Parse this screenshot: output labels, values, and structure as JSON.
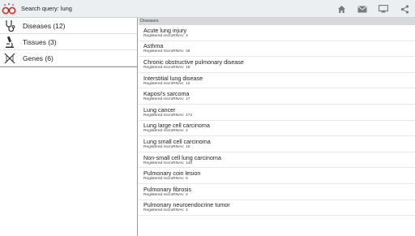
{
  "header": {
    "title": "Search query: lung",
    "actions": [
      {
        "name": "home-icon"
      },
      {
        "name": "mail-icon"
      },
      {
        "name": "cast-screen-icon"
      },
      {
        "name": "share-icon"
      }
    ]
  },
  "sidebar": {
    "items": [
      {
        "label": "Diseases (12)",
        "icon": "stethoscope-icon"
      },
      {
        "label": "Tissues (3)",
        "icon": "microscope-icon"
      },
      {
        "label": "Genes (6)",
        "icon": "dna-icon"
      }
    ]
  },
  "main": {
    "section_label": "Diseases",
    "sub_prefix": "Registered microRNAs:",
    "rows": [
      {
        "name": "Acute lung injury",
        "count": "3"
      },
      {
        "name": "Asthma",
        "count": "26"
      },
      {
        "name": "Chronic obstructive pulmonary disease",
        "count": "18"
      },
      {
        "name": "Interstitial lung disease",
        "count": "12"
      },
      {
        "name": "Kaposi's sarcoma",
        "count": "17"
      },
      {
        "name": "Lung cancer",
        "count": "172"
      },
      {
        "name": "Lung large cell carcinoma",
        "count": "2"
      },
      {
        "name": "Lung small cell carcinoma",
        "count": "10"
      },
      {
        "name": "Non-small cell lung carcinoma",
        "count": "140"
      },
      {
        "name": "Pulmonary coin lesion",
        "count": "5"
      },
      {
        "name": "Pulmonary fibrosis",
        "count": "2"
      },
      {
        "name": "Pulmonary neuroendocrine tumor",
        "count": "2"
      }
    ]
  },
  "colors": {
    "actionbar": "#eceff2",
    "section_header": "#d9d9d9",
    "logo_red": "#d32f2f",
    "icon_gray": "#777777"
  }
}
